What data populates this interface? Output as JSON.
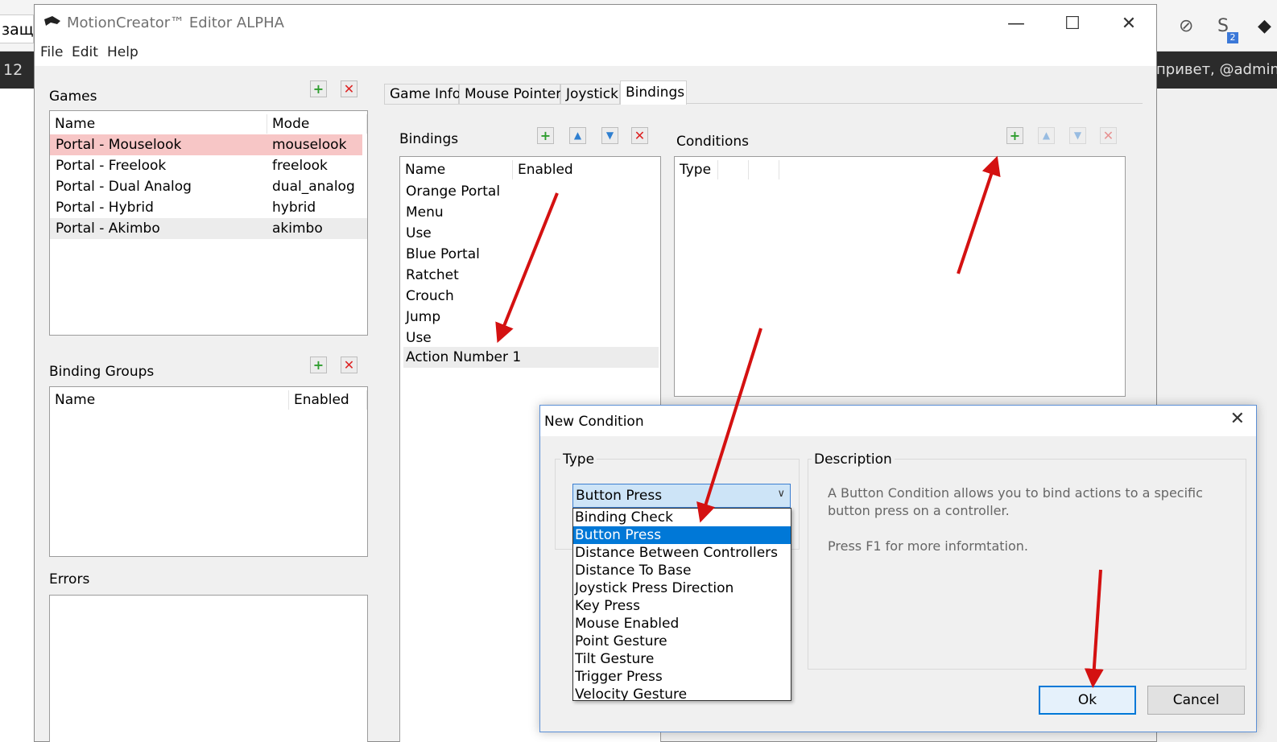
{
  "background": {
    "left_tab_text": "защи",
    "left_dark_text": "12",
    "greeting": "привет, @admin",
    "badge_count": "2"
  },
  "window": {
    "title": "MotionCreator™ Editor ALPHA",
    "menu": [
      "File",
      "Edit",
      "Help"
    ]
  },
  "games": {
    "label": "Games",
    "columns": [
      "Name",
      "Mode"
    ],
    "rows": [
      {
        "name": "Portal - Mouselook",
        "mode": "mouselook"
      },
      {
        "name": "Portal - Freelook",
        "mode": "freelook"
      },
      {
        "name": "Portal - Dual Analog",
        "mode": "dual_analog"
      },
      {
        "name": "Portal - Hybrid",
        "mode": "hybrid"
      },
      {
        "name": "Portal - Akimbo",
        "mode": "akimbo"
      }
    ]
  },
  "binding_groups": {
    "label": "Binding Groups",
    "columns": [
      "Name",
      "Enabled"
    ]
  },
  "errors": {
    "label": "Errors"
  },
  "tabs": [
    "Game Info",
    "Mouse Pointer",
    "Joystick",
    "Bindings"
  ],
  "bindings": {
    "label": "Bindings",
    "columns": [
      "Name",
      "Enabled"
    ],
    "rows": [
      "Orange Portal",
      "Menu",
      "Use",
      "Blue Portal",
      "Ratchet",
      "Crouch",
      "Jump",
      "Use",
      "Action Number 1"
    ]
  },
  "conditions": {
    "label": "Conditions",
    "columns": [
      "Type"
    ]
  },
  "dialog": {
    "title": "New Condition",
    "type_label": "Type",
    "description_label": "Description",
    "selected_type": "Button Press",
    "options": [
      "Binding Check",
      "Button Press",
      "Distance Between Controllers",
      "Distance To Base",
      "Joystick Press Direction",
      "Key Press",
      "Mouse Enabled",
      "Point Gesture",
      "Tilt Gesture",
      "Trigger Press",
      "Velocity Gesture"
    ],
    "description_line1": "A Button Condition allows you to bind actions to a specific button press on a controller.",
    "description_line2": "Press F1 for more informtation.",
    "ok_label": "Ok",
    "cancel_label": "Cancel"
  },
  "colors": {
    "selected_row": "#f7c6c6",
    "dropdown_selection": "#0078d7",
    "annotation_arrow": "#d41111"
  }
}
